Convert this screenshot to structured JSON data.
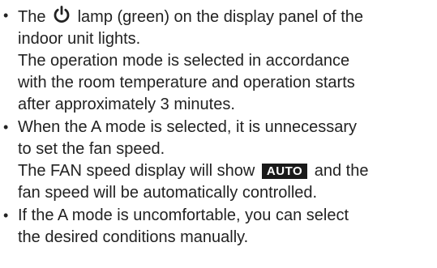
{
  "bullet_char": "•",
  "items": [
    {
      "l1_before": "The",
      "l1_icon": "power-icon",
      "l1_after": "lamp (green) on the display panel of the",
      "l2": "indoor unit lights.",
      "l3": "The operation mode is selected in accordance",
      "l4": "with the room temperature and operation starts",
      "l5": "after approximately 3 minutes."
    },
    {
      "l1": "When the A mode is selected, it is unnecessary",
      "l2": "to set the fan speed.",
      "l3_before": "The FAN speed display will show",
      "l3_badge": "AUTO",
      "l3_after": "and the",
      "l4": "fan speed will be automatically controlled."
    },
    {
      "l1": "If the A mode is uncomfortable, you can select",
      "l2": "the desired conditions manually."
    }
  ],
  "colors": {
    "text": "#222222",
    "badge_bg": "#1a1a1a",
    "badge_text": "#ffffff"
  }
}
